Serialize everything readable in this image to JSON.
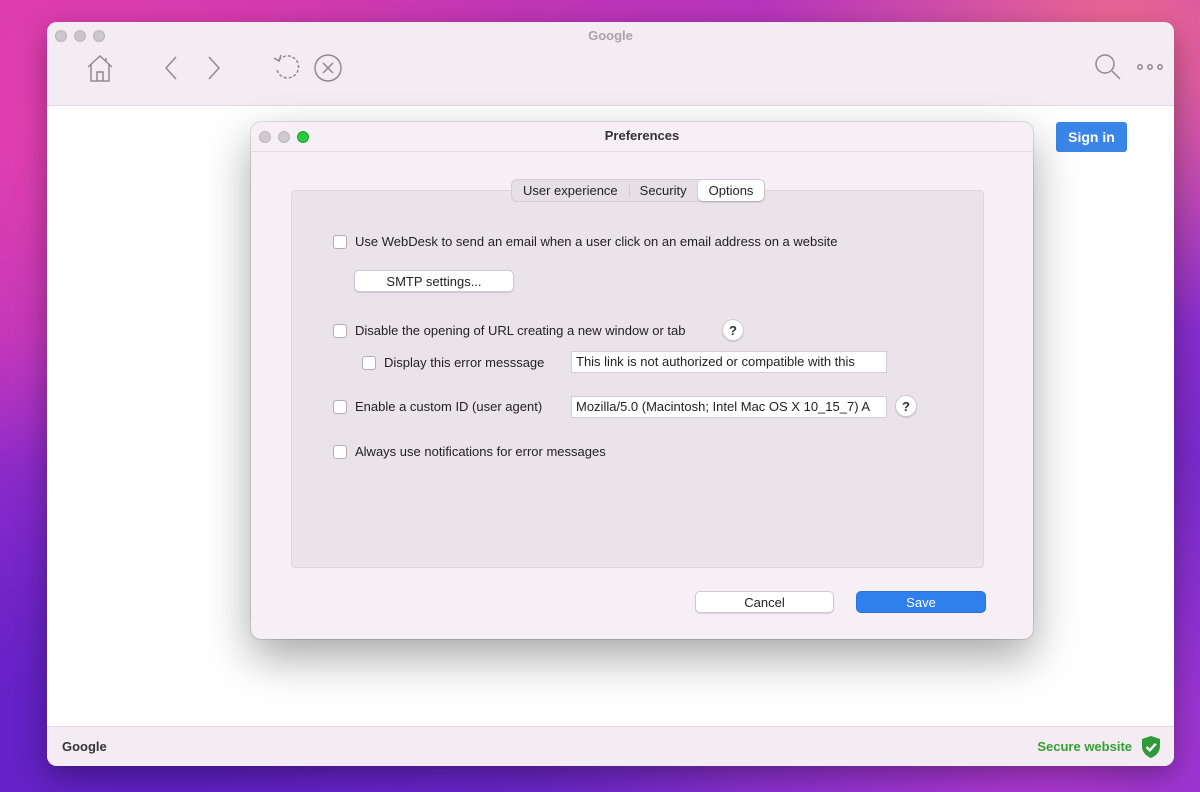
{
  "browser": {
    "title": "Google",
    "toolbar_icons": [
      "home-icon",
      "back-icon",
      "forward-icon",
      "reload-icon",
      "stop-icon",
      "search-icon",
      "more-icon"
    ],
    "sign_in_label": "Sign in",
    "status_left": "Google",
    "status_right": "Secure website",
    "colors": {
      "accent": "#3a86e8",
      "secure": "#35a035"
    }
  },
  "dialog": {
    "title": "Preferences",
    "tabs": [
      {
        "label": "User experience",
        "active": false
      },
      {
        "label": "Security",
        "active": false
      },
      {
        "label": "Options",
        "active": true
      }
    ],
    "options": {
      "webdesk_email": {
        "label": "Use WebDesk to send an email when a user click on an email address on a website",
        "checked": false
      },
      "smtp_button": "SMTP settings...",
      "disable_url": {
        "label": "Disable the opening of URL creating a new window or tab",
        "checked": false
      },
      "display_error": {
        "label": "Display this error messsage",
        "checked": false,
        "value": "This link is not authorized or compatible with this"
      },
      "custom_id": {
        "label": "Enable a custom ID (user agent)",
        "checked": false,
        "value": "Mozilla/5.0 (Macintosh; Intel Mac OS X 10_15_7) A"
      },
      "notifications": {
        "label": "Always use notifications for error messages",
        "checked": false
      },
      "help_label": "?"
    },
    "cancel_label": "Cancel",
    "save_label": "Save"
  }
}
